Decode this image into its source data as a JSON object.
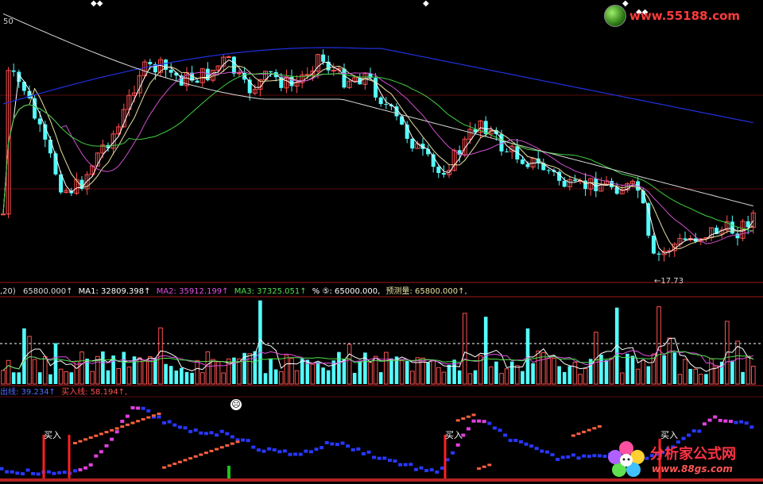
{
  "price_panel": {
    "scale_label": "50",
    "low_marker": "←17.73"
  },
  "volume_panel": {
    "prefix": ",20)",
    "vol_value": "65800.000↑",
    "ma1_label": "MA1:",
    "ma1_value": "32809.398↑",
    "ma2_label": "MA2:",
    "ma2_value": "35912.199↑",
    "ma3_label": "MA3:",
    "ma3_value": "37325.051↑",
    "mid_text": "% ⑤: 65000.000,",
    "forecast_label": "预测量:",
    "forecast_value": "65800.000↑,"
  },
  "indicator_panel": {
    "sell_line_label": "出线:",
    "sell_line_value": "39.234↑",
    "buy_line_label": "买入线:",
    "buy_line_value": "58.194↑,",
    "buy_signal_text": "买入",
    "face_icon": "sad-face-icon"
  },
  "watermarks": {
    "top_site": "www.55188.com",
    "bottom_cn": "分析家公式网",
    "bottom_url": "www.88gs.com"
  },
  "colors": {
    "bg": "#000000",
    "up": "#ff5050",
    "down": "#54fcfc",
    "ma_white": "#ffffff",
    "ma_yellow": "#e8e0a0",
    "ma_magenta": "#d050d0",
    "ma_green": "#40d040",
    "ma_blue": "#2030e0",
    "divider": "#a01818"
  }
}
